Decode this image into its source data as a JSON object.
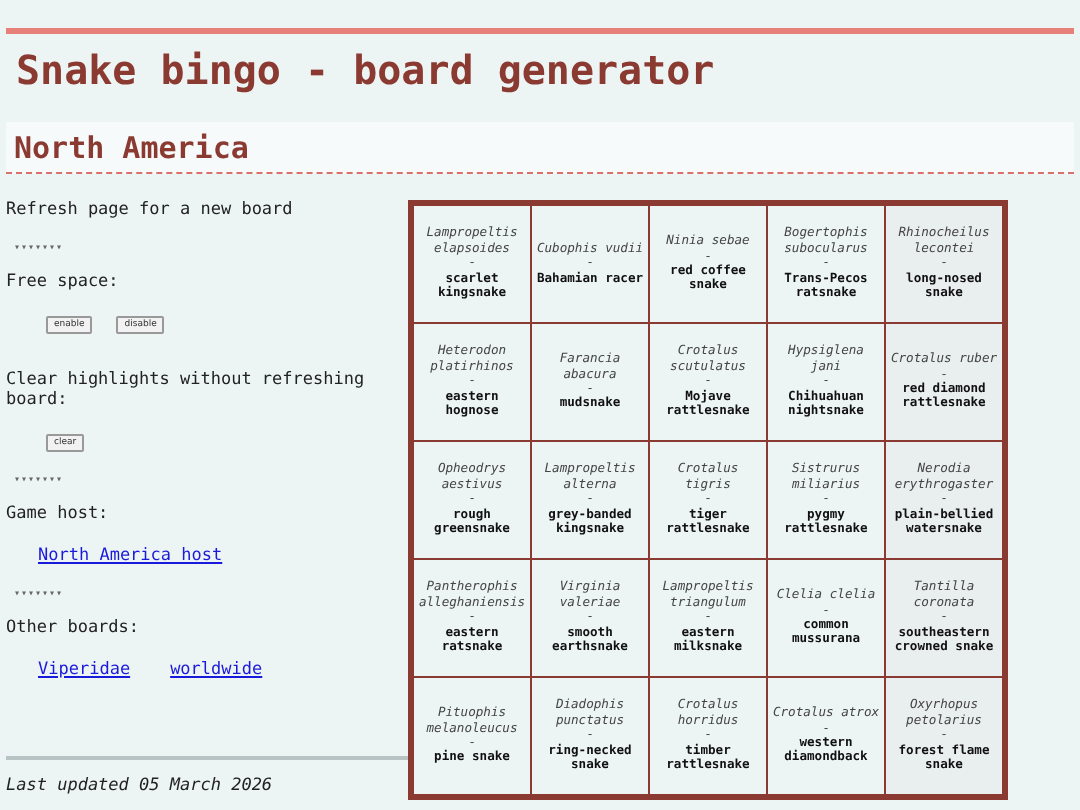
{
  "title": "Snake bingo - board generator",
  "section": "North America",
  "sidebar": {
    "refresh_note": "Refresh page for a new board",
    "separators": [
      "▾▾▾▾▾▾▾",
      "▾▾▾▾▾▾▾",
      "▾▾▾▾▾▾▾"
    ],
    "free_space_label": "Free space:",
    "free_space_buttons": [
      "enable",
      "disable"
    ],
    "clear_label": "Clear highlights without refreshing board:",
    "clear_button": "clear",
    "host_label": "Game host:",
    "host_link": "North America host",
    "other_label": "Other boards:",
    "other_links": [
      "Viperidae",
      "worldwide"
    ],
    "last_updated": "Last updated 05 March 2026"
  },
  "board": [
    [
      {
        "scientific": "Lampropeltis elapsoides",
        "dash": "-",
        "common": "scarlet kingsnake"
      },
      {
        "scientific": "Cubophis vudii",
        "dash": "-",
        "common": "Bahamian racer"
      },
      {
        "scientific": "Ninia sebae",
        "dash": "-",
        "common": "red coffee snake"
      },
      {
        "scientific": "Bogertophis subocularus",
        "dash": "-",
        "common": "Trans-Pecos ratsnake"
      },
      {
        "scientific": "Rhinocheilus lecontei",
        "dash": "-",
        "common": "long-nosed snake"
      }
    ],
    [
      {
        "scientific": "Heterodon platirhinos",
        "dash": "-",
        "common": "eastern hognose"
      },
      {
        "scientific": "Farancia abacura",
        "dash": "-",
        "common": "mudsnake"
      },
      {
        "scientific": "Crotalus scutulatus",
        "dash": "-",
        "common": "Mojave rattlesnake"
      },
      {
        "scientific": "Hypsiglena jani",
        "dash": "-",
        "common": "Chihuahuan nightsnake"
      },
      {
        "scientific": "Crotalus ruber",
        "dash": "-",
        "common": "red diamond rattlesnake"
      }
    ],
    [
      {
        "scientific": "Opheodrys aestivus",
        "dash": "-",
        "common": "rough greensnake"
      },
      {
        "scientific": "Lampropeltis alterna",
        "dash": "-",
        "common": "grey-banded kingsnake"
      },
      {
        "scientific": "Crotalus tigris",
        "dash": "-",
        "common": "tiger rattlesnake"
      },
      {
        "scientific": "Sistrurus miliarius",
        "dash": "-",
        "common": "pygmy rattlesnake"
      },
      {
        "scientific": "Nerodia erythrogaster",
        "dash": "-",
        "common": "plain-bellied watersnake"
      }
    ],
    [
      {
        "scientific": "Pantherophis alleghaniensis",
        "dash": "-",
        "common": "eastern ratsnake"
      },
      {
        "scientific": "Virginia valeriae",
        "dash": "-",
        "common": "smooth earthsnake"
      },
      {
        "scientific": "Lampropeltis triangulum",
        "dash": "-",
        "common": "eastern milksnake"
      },
      {
        "scientific": "Clelia clelia",
        "dash": "-",
        "common": "common mussurana"
      },
      {
        "scientific": "Tantilla coronata",
        "dash": "-",
        "common": "southeastern crowned snake"
      }
    ],
    [
      {
        "scientific": "Pituophis melanoleucus",
        "dash": "-",
        "common": "pine snake"
      },
      {
        "scientific": "Diadophis punctatus",
        "dash": "-",
        "common": "ring-necked snake"
      },
      {
        "scientific": "Crotalus horridus",
        "dash": "-",
        "common": "timber rattlesnake"
      },
      {
        "scientific": "Crotalus atrox",
        "dash": "-",
        "common": "western diamondback"
      },
      {
        "scientific": "Oxyrhopus petolarius",
        "dash": "-",
        "common": "forest flame snake"
      }
    ]
  ]
}
